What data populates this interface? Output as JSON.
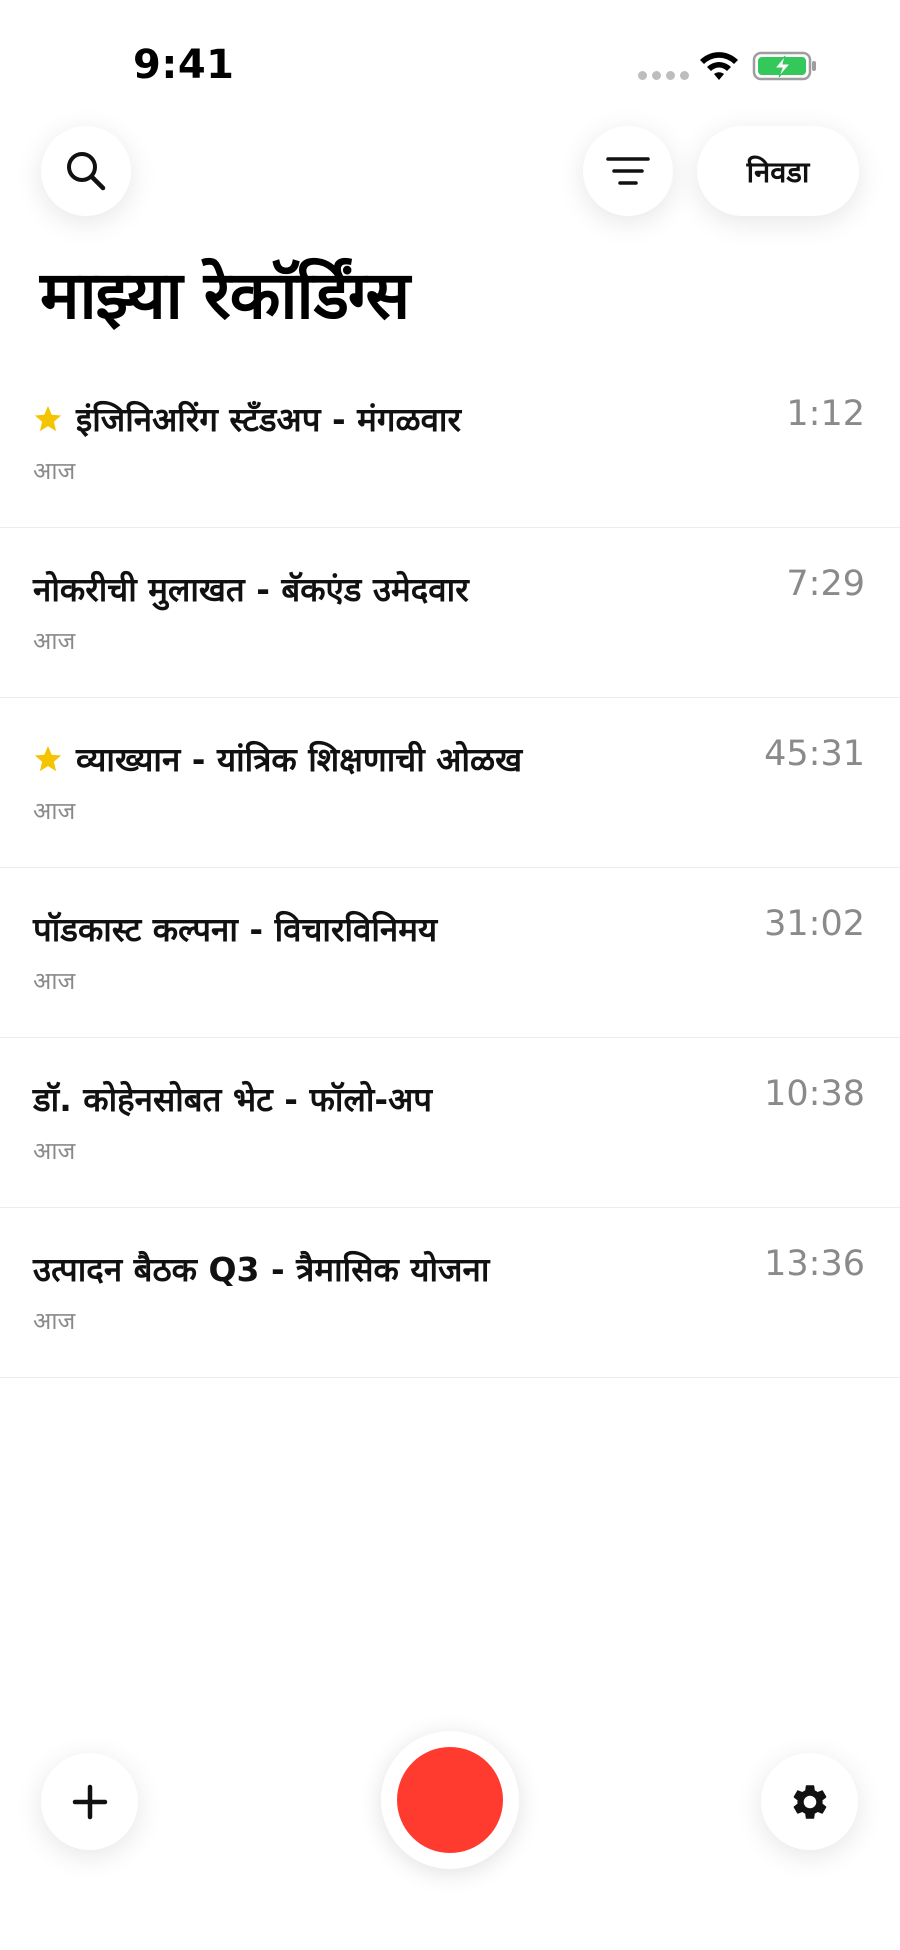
{
  "status_bar": {
    "time": "9:41"
  },
  "toolbar": {
    "search_icon": "search-icon",
    "filter_icon": "filter-lines-icon",
    "select_label": "निवडा"
  },
  "page": {
    "title": "माझ्या रेकॉर्डिंग्स"
  },
  "recordings": [
    {
      "title": "इंजिनिअरिंग स्टँडअप - मंगळवार",
      "date": "आज",
      "duration": "1:12",
      "starred": true
    },
    {
      "title": "नोकरीची मुलाखत - बॅकएंड उमेदवार",
      "date": "आज",
      "duration": "7:29",
      "starred": false
    },
    {
      "title": "व्याख्यान - यांत्रिक शिक्षणाची ओळख",
      "date": "आज",
      "duration": "45:31",
      "starred": true
    },
    {
      "title": "पॉडकास्ट कल्पना - विचारविनिमय",
      "date": "आज",
      "duration": "31:02",
      "starred": false
    },
    {
      "title": "डॉ. कोहेनसोबत भेट - फॉलो-अप",
      "date": "आज",
      "duration": "10:38",
      "starred": false
    },
    {
      "title": "उत्पादन बैठक Q3 - त्रैमासिक योजना",
      "date": "आज",
      "duration": "13:36",
      "starred": false
    }
  ],
  "bottom_bar": {
    "add_icon": "plus-icon",
    "record_icon": "record-icon",
    "settings_icon": "gear-icon"
  },
  "colors": {
    "accent_record": "#ff3b30",
    "star": "#f5c400",
    "battery": "#34c759",
    "secondary_text": "#8a8a8a"
  }
}
